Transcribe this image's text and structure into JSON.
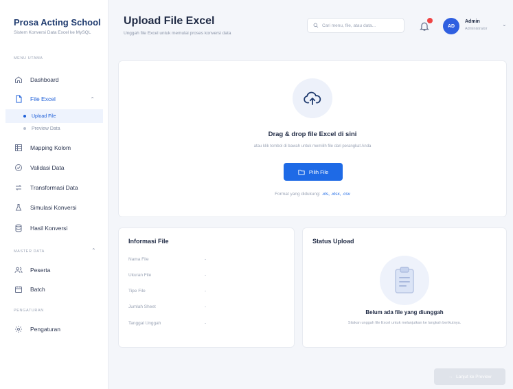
{
  "brand": {
    "title": "Prosa Acting School",
    "subtitle": "Sistem Konversi Data Excel ke MySQL"
  },
  "sidebar": {
    "section_menu": "MENU UTAMA",
    "section_master": "MASTER DATA",
    "section_settings": "PENGATURAN",
    "items": [
      {
        "label": "Dashboard",
        "icon": "home-icon"
      },
      {
        "label": "File Excel",
        "icon": "file-icon",
        "expanded": true
      },
      {
        "label": "Mapping Kolom",
        "icon": "table-icon"
      },
      {
        "label": "Validasi Data",
        "icon": "check-circle-icon"
      },
      {
        "label": "Transformasi Data",
        "icon": "transfer-icon"
      },
      {
        "label": "Simulasi Konversi",
        "icon": "flask-icon"
      },
      {
        "label": "Hasil Konversi",
        "icon": "database-icon"
      }
    ],
    "sub_items": [
      {
        "label": "Upload File",
        "active": true
      },
      {
        "label": "Preview Data",
        "active": false
      }
    ],
    "master_items": [
      {
        "label": "Peserta",
        "icon": "users-icon"
      },
      {
        "label": "Batch",
        "icon": "calendar-icon"
      }
    ],
    "settings_items": [
      {
        "label": "Pengaturan",
        "icon": "gear-icon"
      }
    ]
  },
  "header": {
    "title": "Upload File Excel",
    "subtitle": "Unggah file Excel untuk memulai proses konversi data",
    "search_placeholder": "Cari menu, file, atau data...",
    "user_initials": "AD",
    "user_name": "Admin",
    "user_role": "Administrator"
  },
  "upload": {
    "title": "Drag & drop file Excel di sini",
    "subtitle": "atau klik tombol di bawah untuk memilih file dari perangkat Anda",
    "button_label": "Pilih File",
    "formats_prefix": "Format yang didukung: ",
    "formats_ext": ".xls, .xlsx, .csv"
  },
  "file_info": {
    "title": "Informasi File",
    "rows": [
      {
        "label": "Nama File",
        "value": "-"
      },
      {
        "label": "Ukuran File",
        "value": "-"
      },
      {
        "label": "Tipe File",
        "value": "-"
      },
      {
        "label": "Jumlah Sheet",
        "value": "-"
      },
      {
        "label": "Tanggal Unggah",
        "value": "-"
      }
    ]
  },
  "status": {
    "title": "Status Upload",
    "message": "Belum ada file yang diunggah",
    "sub": "Silakan unggah file Excel untuk melanjutkan ke langkah berikutnya."
  },
  "footer": {
    "next_label": "Lanjut ke Preview"
  },
  "colors": {
    "accent": "#1e6ae6",
    "brand": "#1e3a6e",
    "badge": "#ef4444"
  }
}
